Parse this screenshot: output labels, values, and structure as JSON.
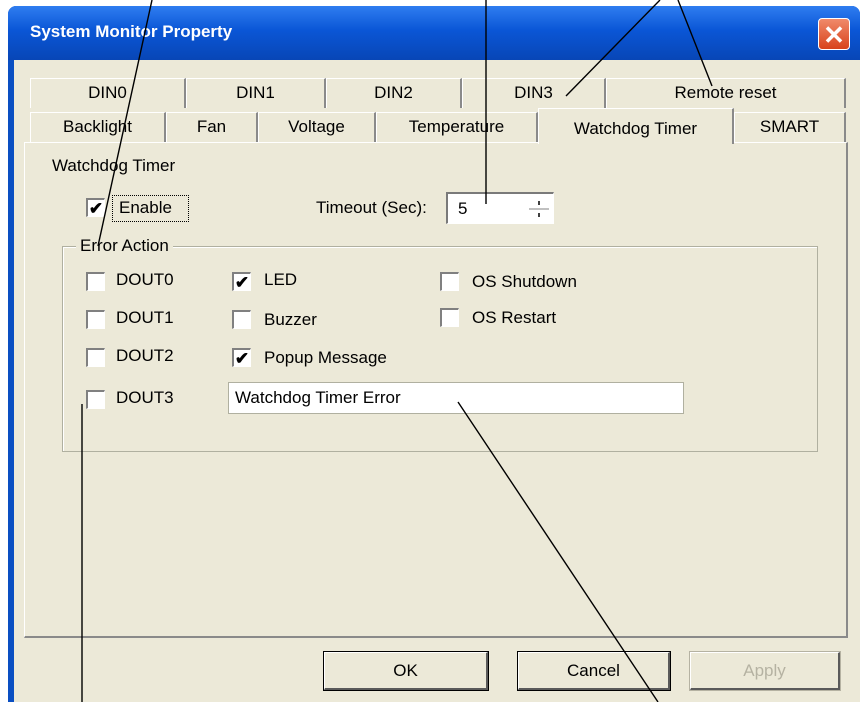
{
  "window": {
    "title": "System Monitor Property",
    "close_glyph": "✕"
  },
  "tabs_back": [
    {
      "label": "DIN0"
    },
    {
      "label": "DIN1"
    },
    {
      "label": "DIN2"
    },
    {
      "label": "DIN3"
    },
    {
      "label": "Remote reset"
    }
  ],
  "tabs_front": [
    {
      "label": "Backlight"
    },
    {
      "label": "Fan"
    },
    {
      "label": "Voltage"
    },
    {
      "label": "Temperature"
    },
    {
      "label": "Watchdog Timer",
      "active": true
    },
    {
      "label": "SMART"
    }
  ],
  "watchdog": {
    "section_label": "Watchdog Timer",
    "enable_label": "Enable",
    "enable_checked": true,
    "timeout_label": "Timeout (Sec):",
    "timeout_value": "5"
  },
  "error_action": {
    "group_label": "Error Action",
    "dout": [
      {
        "label": "DOUT0",
        "checked": false
      },
      {
        "label": "DOUT1",
        "checked": false
      },
      {
        "label": "DOUT2",
        "checked": false
      },
      {
        "label": "DOUT3",
        "checked": false
      }
    ],
    "led": {
      "label": "LED",
      "checked": true
    },
    "buzzer": {
      "label": "Buzzer",
      "checked": false
    },
    "popup": {
      "label": "Popup Message",
      "checked": true
    },
    "popup_text": "Watchdog Timer Error",
    "os_shutdown": {
      "label": "OS Shutdown",
      "checked": false
    },
    "os_restart": {
      "label": "OS Restart",
      "checked": false
    }
  },
  "buttons": {
    "ok": "OK",
    "cancel": "Cancel",
    "apply": "Apply"
  },
  "icons": {
    "check": "✔",
    "spinner": "spinner-arrows-icon"
  },
  "colors": {
    "title_bar": "#0a56d6",
    "dialog_bg": "#ece9d8",
    "close_button": "#d8431c"
  }
}
